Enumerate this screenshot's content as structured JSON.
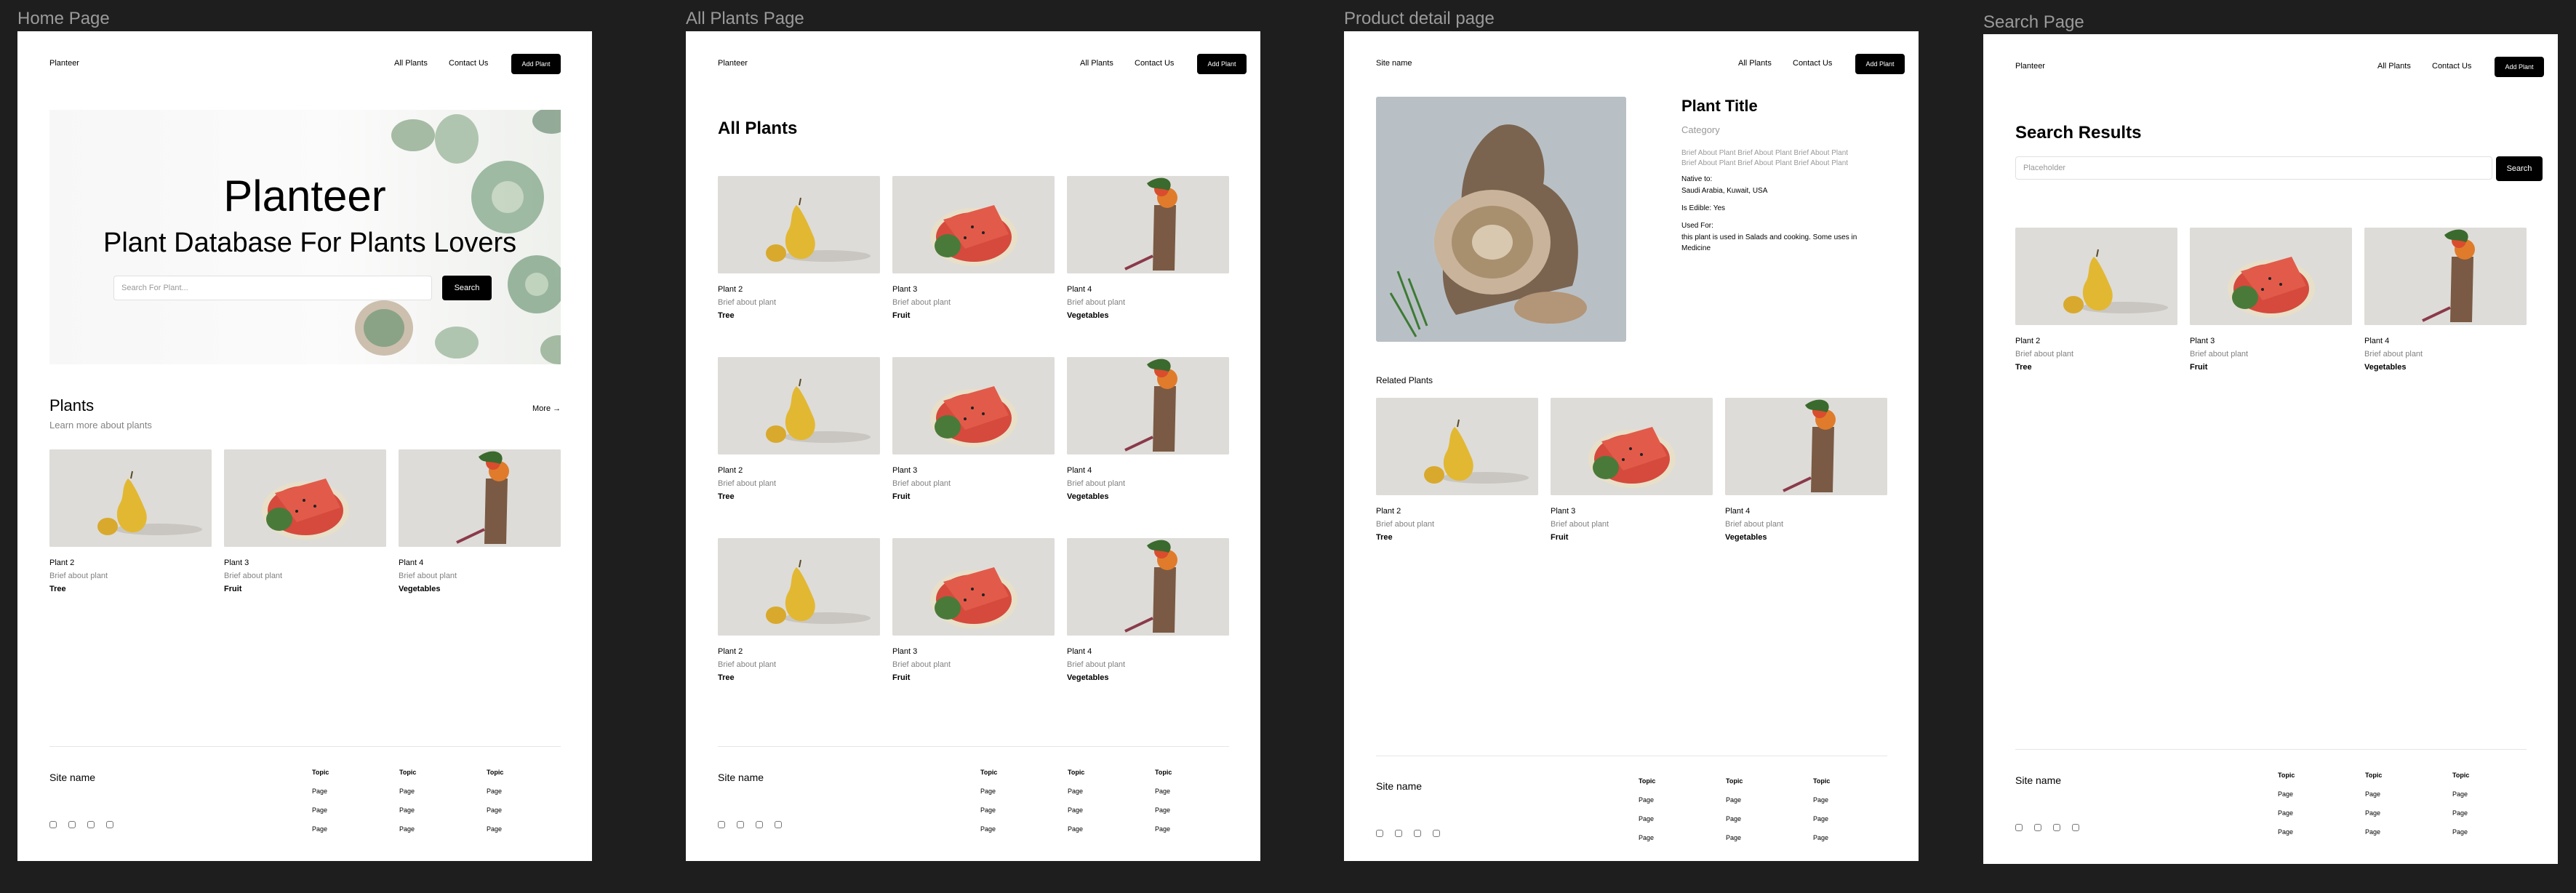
{
  "frames": {
    "home_label": "Home Page",
    "all_plants_label": "All Plants Page",
    "detail_label": "Product detail page",
    "search_label": "Search Page"
  },
  "nav": {
    "brand": "Planteer",
    "brand_detail": "Site name",
    "all_plants": "All Plants",
    "contact": "Contact Us",
    "add_plant": "Add Plant"
  },
  "home": {
    "hero_title": "Planteer",
    "hero_subtitle": "Plant Database For Plants Lovers",
    "search_placeholder": "Search For Plant...",
    "search_button": "Search",
    "section_title": "Plants",
    "section_subtitle": "Learn more about plants",
    "more_link": "More →"
  },
  "all_plants": {
    "title": "All Plants"
  },
  "detail": {
    "title": "Plant Title",
    "category": "Category",
    "about_1": "Brief About Plant Brief About Plant Brief About Plant",
    "about_2": "Brief About Plant Brief About Plant Brief About Plant",
    "native_label": "Native to:",
    "native_value": "Saudi Arabia, Kuwait, USA",
    "edible": "Is Edible: Yes",
    "used_label": "Used For:",
    "used_1": "this plant is used in Salads and cooking. Some uses in",
    "used_2": "Medicine",
    "related_title": "Related Plants"
  },
  "search": {
    "title": "Search Results",
    "placeholder": "Placeholder",
    "button": "Search"
  },
  "plants": [
    {
      "name": "Plant 2",
      "brief": "Brief about plant",
      "category": "Tree",
      "image": "pear"
    },
    {
      "name": "Plant 3",
      "brief": "Brief about plant",
      "category": "Fruit",
      "image": "watermelon"
    },
    {
      "name": "Plant 4",
      "brief": "Brief about plant",
      "category": "Vegetables",
      "image": "vegetables"
    }
  ],
  "footer": {
    "site_name": "Site name",
    "topic": "Topic",
    "page": "Page",
    "social_icons": [
      "facebook-icon",
      "linkedin-icon",
      "youtube-icon",
      "instagram-icon"
    ]
  }
}
